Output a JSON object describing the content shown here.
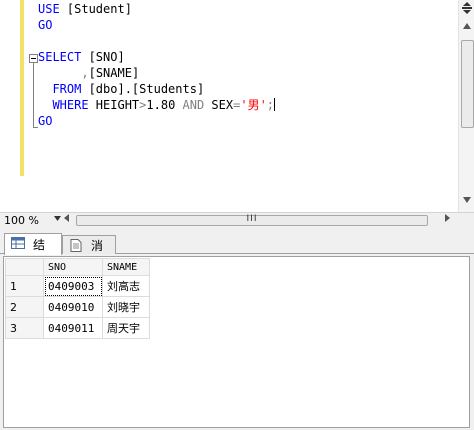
{
  "editor": {
    "lines": {
      "l1_kw": "USE",
      "l1_rest": " [Student]",
      "l2_kw": "GO",
      "l4_kw": "SELECT",
      "l4_rest": " [SNO]",
      "l5_op": ",",
      "l5_rest": "[SNAME]",
      "l6_kw": "FROM",
      "l6_rest": " [dbo].[Students]",
      "l7_kw": "WHERE",
      "l7_a": " HEIGHT",
      "l7_op1": ">",
      "l7_b": "1.80 ",
      "l7_and": "AND",
      "l7_c": " SEX",
      "l7_op2": "=",
      "l7_str": "'男'",
      "l7_semi": ";",
      "l8_kw": "GO"
    }
  },
  "status": {
    "zoom": "100 %",
    "grip": "III"
  },
  "results": {
    "tabs": [
      {
        "label": "结果"
      },
      {
        "label": "消息"
      }
    ],
    "columns": [
      "SNO",
      "SNAME"
    ],
    "rows": [
      {
        "num": "1",
        "sno": "0409003",
        "sname": "刘高志"
      },
      {
        "num": "2",
        "sno": "0409010",
        "sname": "刘晓宇"
      },
      {
        "num": "3",
        "sno": "0409011",
        "sname": "周天宇"
      }
    ]
  },
  "colors": {
    "keyword": "#0000ff",
    "string": "#ff0000",
    "operator": "#808080",
    "change_bar": "#f2e265"
  }
}
